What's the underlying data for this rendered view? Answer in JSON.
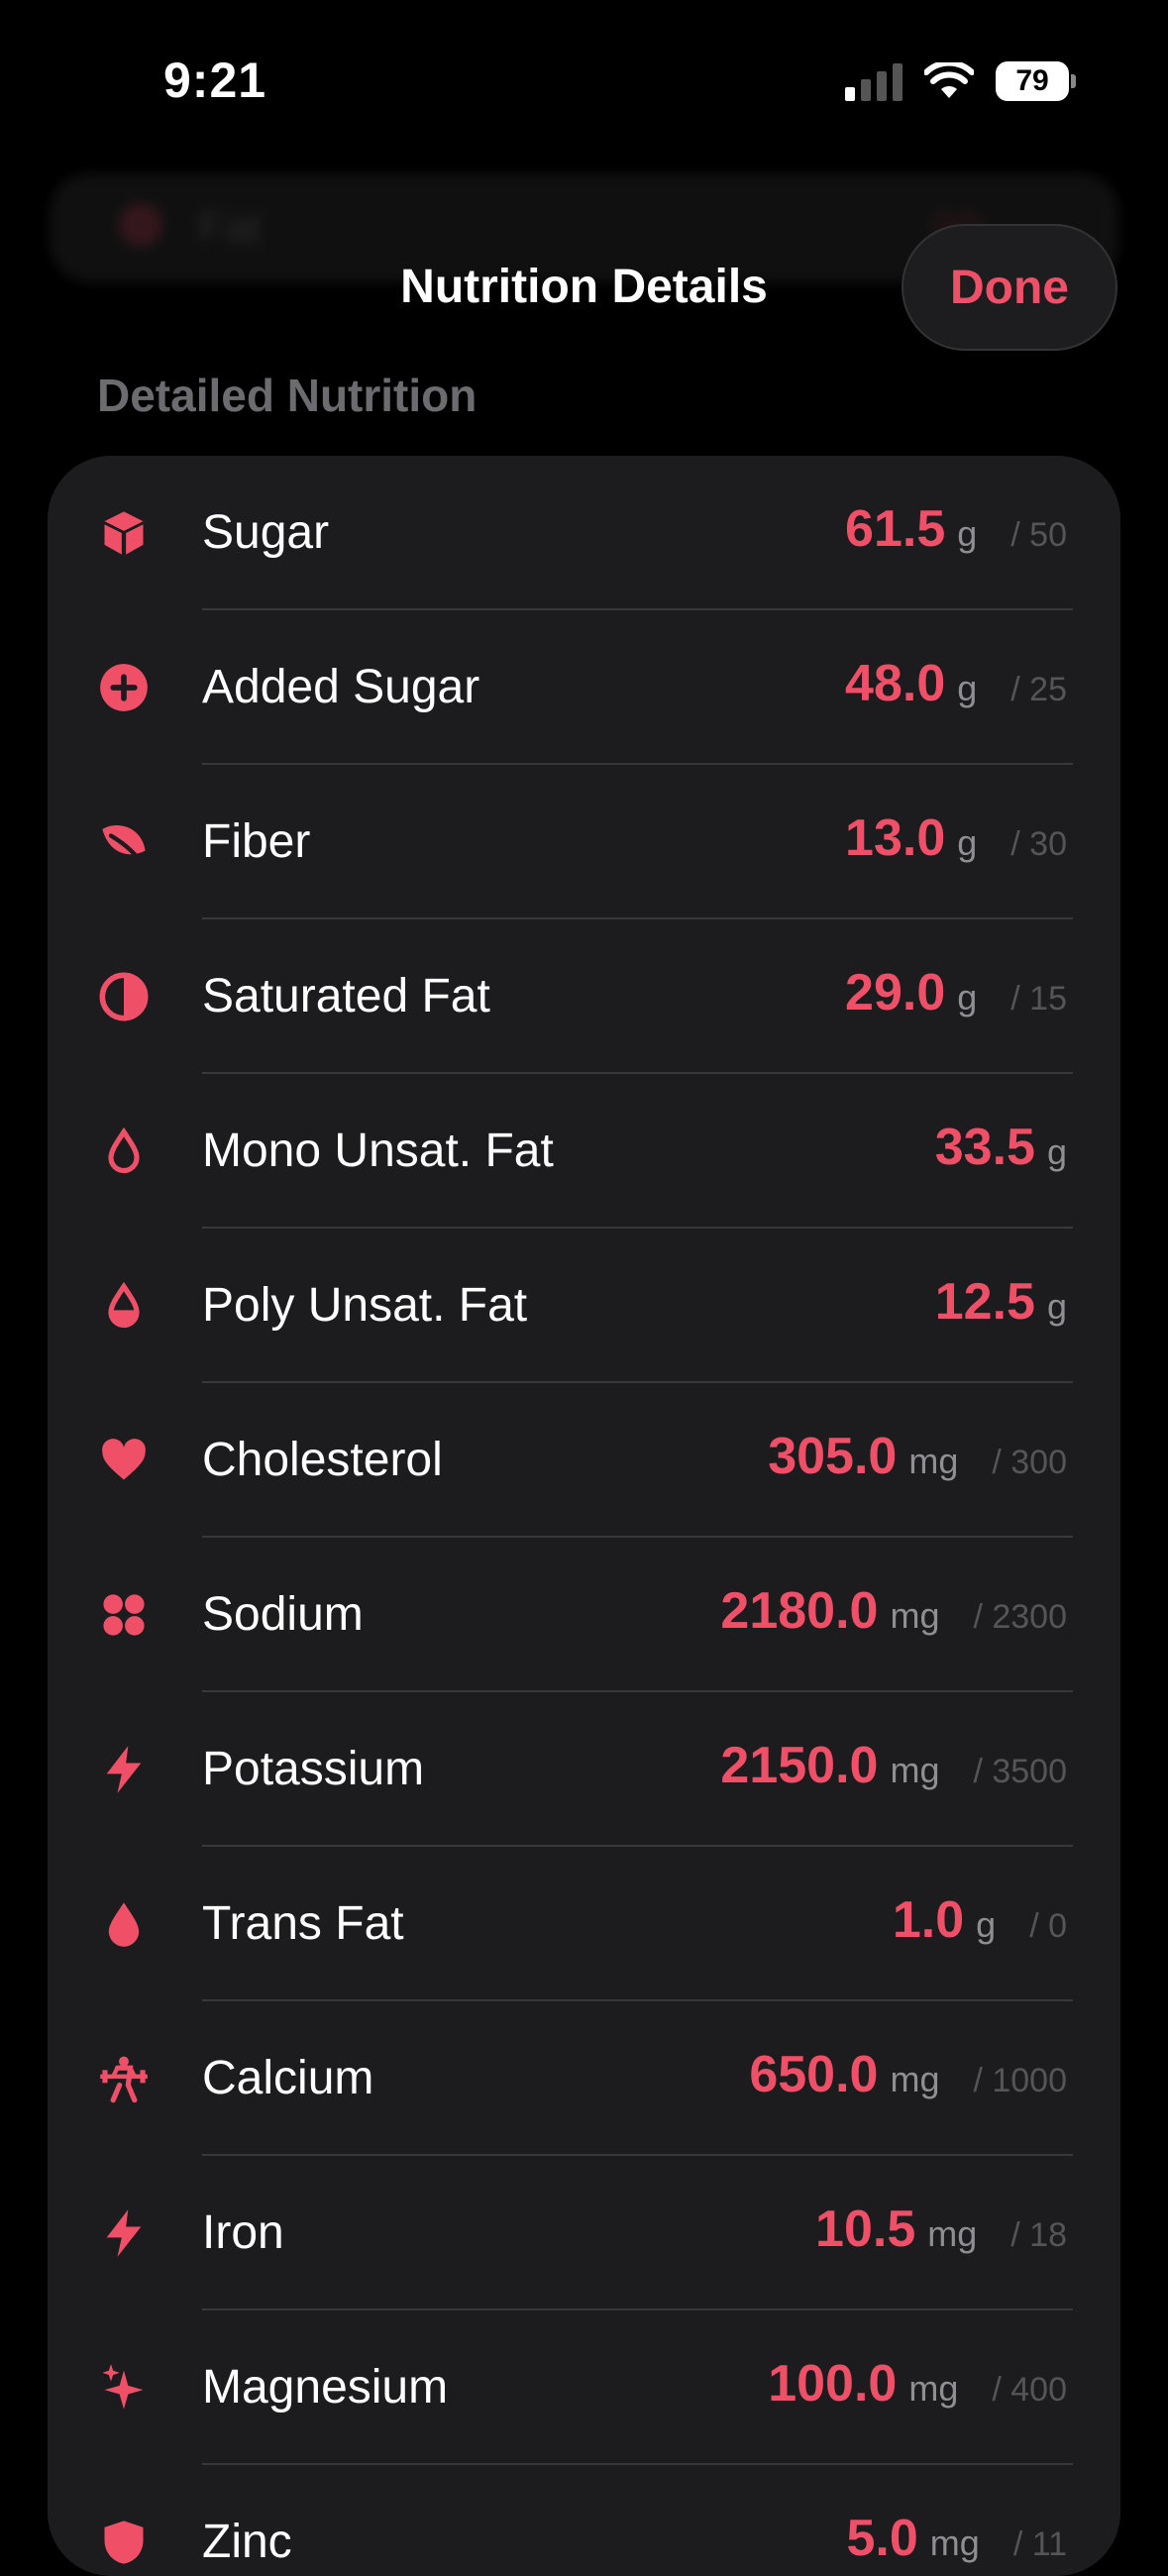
{
  "status": {
    "time": "9:21",
    "battery": "79"
  },
  "background_row": {
    "label": "Fat",
    "value": "90"
  },
  "nav": {
    "title": "Nutrition Details",
    "done_label": "Done"
  },
  "section": {
    "title": "Detailed Nutrition"
  },
  "colors": {
    "accent": "#ef5068",
    "background": "#000000",
    "card": "#1c1c1e"
  },
  "nutrients": [
    {
      "icon": "cube-icon",
      "label": "Sugar",
      "value": "61.5",
      "unit": "g",
      "goal": "/ 50"
    },
    {
      "icon": "plus-circle-icon",
      "label": "Added Sugar",
      "value": "48.0",
      "unit": "g",
      "goal": "/ 25"
    },
    {
      "icon": "leaf-icon",
      "label": "Fiber",
      "value": "13.0",
      "unit": "g",
      "goal": "/ 30"
    },
    {
      "icon": "half-circle-icon",
      "label": "Saturated Fat",
      "value": "29.0",
      "unit": "g",
      "goal": "/ 15"
    },
    {
      "icon": "drop-outline-icon",
      "label": "Mono Unsat. Fat",
      "value": "33.5",
      "unit": "g",
      "goal": ""
    },
    {
      "icon": "drop-half-icon",
      "label": "Poly Unsat. Fat",
      "value": "12.5",
      "unit": "g",
      "goal": ""
    },
    {
      "icon": "heart-icon",
      "label": "Cholesterol",
      "value": "305.0",
      "unit": "mg",
      "goal": "/ 300"
    },
    {
      "icon": "four-dots-icon",
      "label": "Sodium",
      "value": "2180.0",
      "unit": "mg",
      "goal": "/ 2300"
    },
    {
      "icon": "bolt-icon",
      "label": "Potassium",
      "value": "2150.0",
      "unit": "mg",
      "goal": "/ 3500"
    },
    {
      "icon": "drop-filled-icon",
      "label": "Trans Fat",
      "value": "1.0",
      "unit": "g",
      "goal": "/ 0"
    },
    {
      "icon": "weightlifter-icon",
      "label": "Calcium",
      "value": "650.0",
      "unit": "mg",
      "goal": "/ 1000"
    },
    {
      "icon": "bolt-icon",
      "label": "Iron",
      "value": "10.5",
      "unit": "mg",
      "goal": "/ 18"
    },
    {
      "icon": "sparkles-icon",
      "label": "Magnesium",
      "value": "100.0",
      "unit": "mg",
      "goal": "/ 400"
    },
    {
      "icon": "shield-icon",
      "label": "Zinc",
      "value": "5.0",
      "unit": "mg",
      "goal": "/ 11"
    }
  ]
}
